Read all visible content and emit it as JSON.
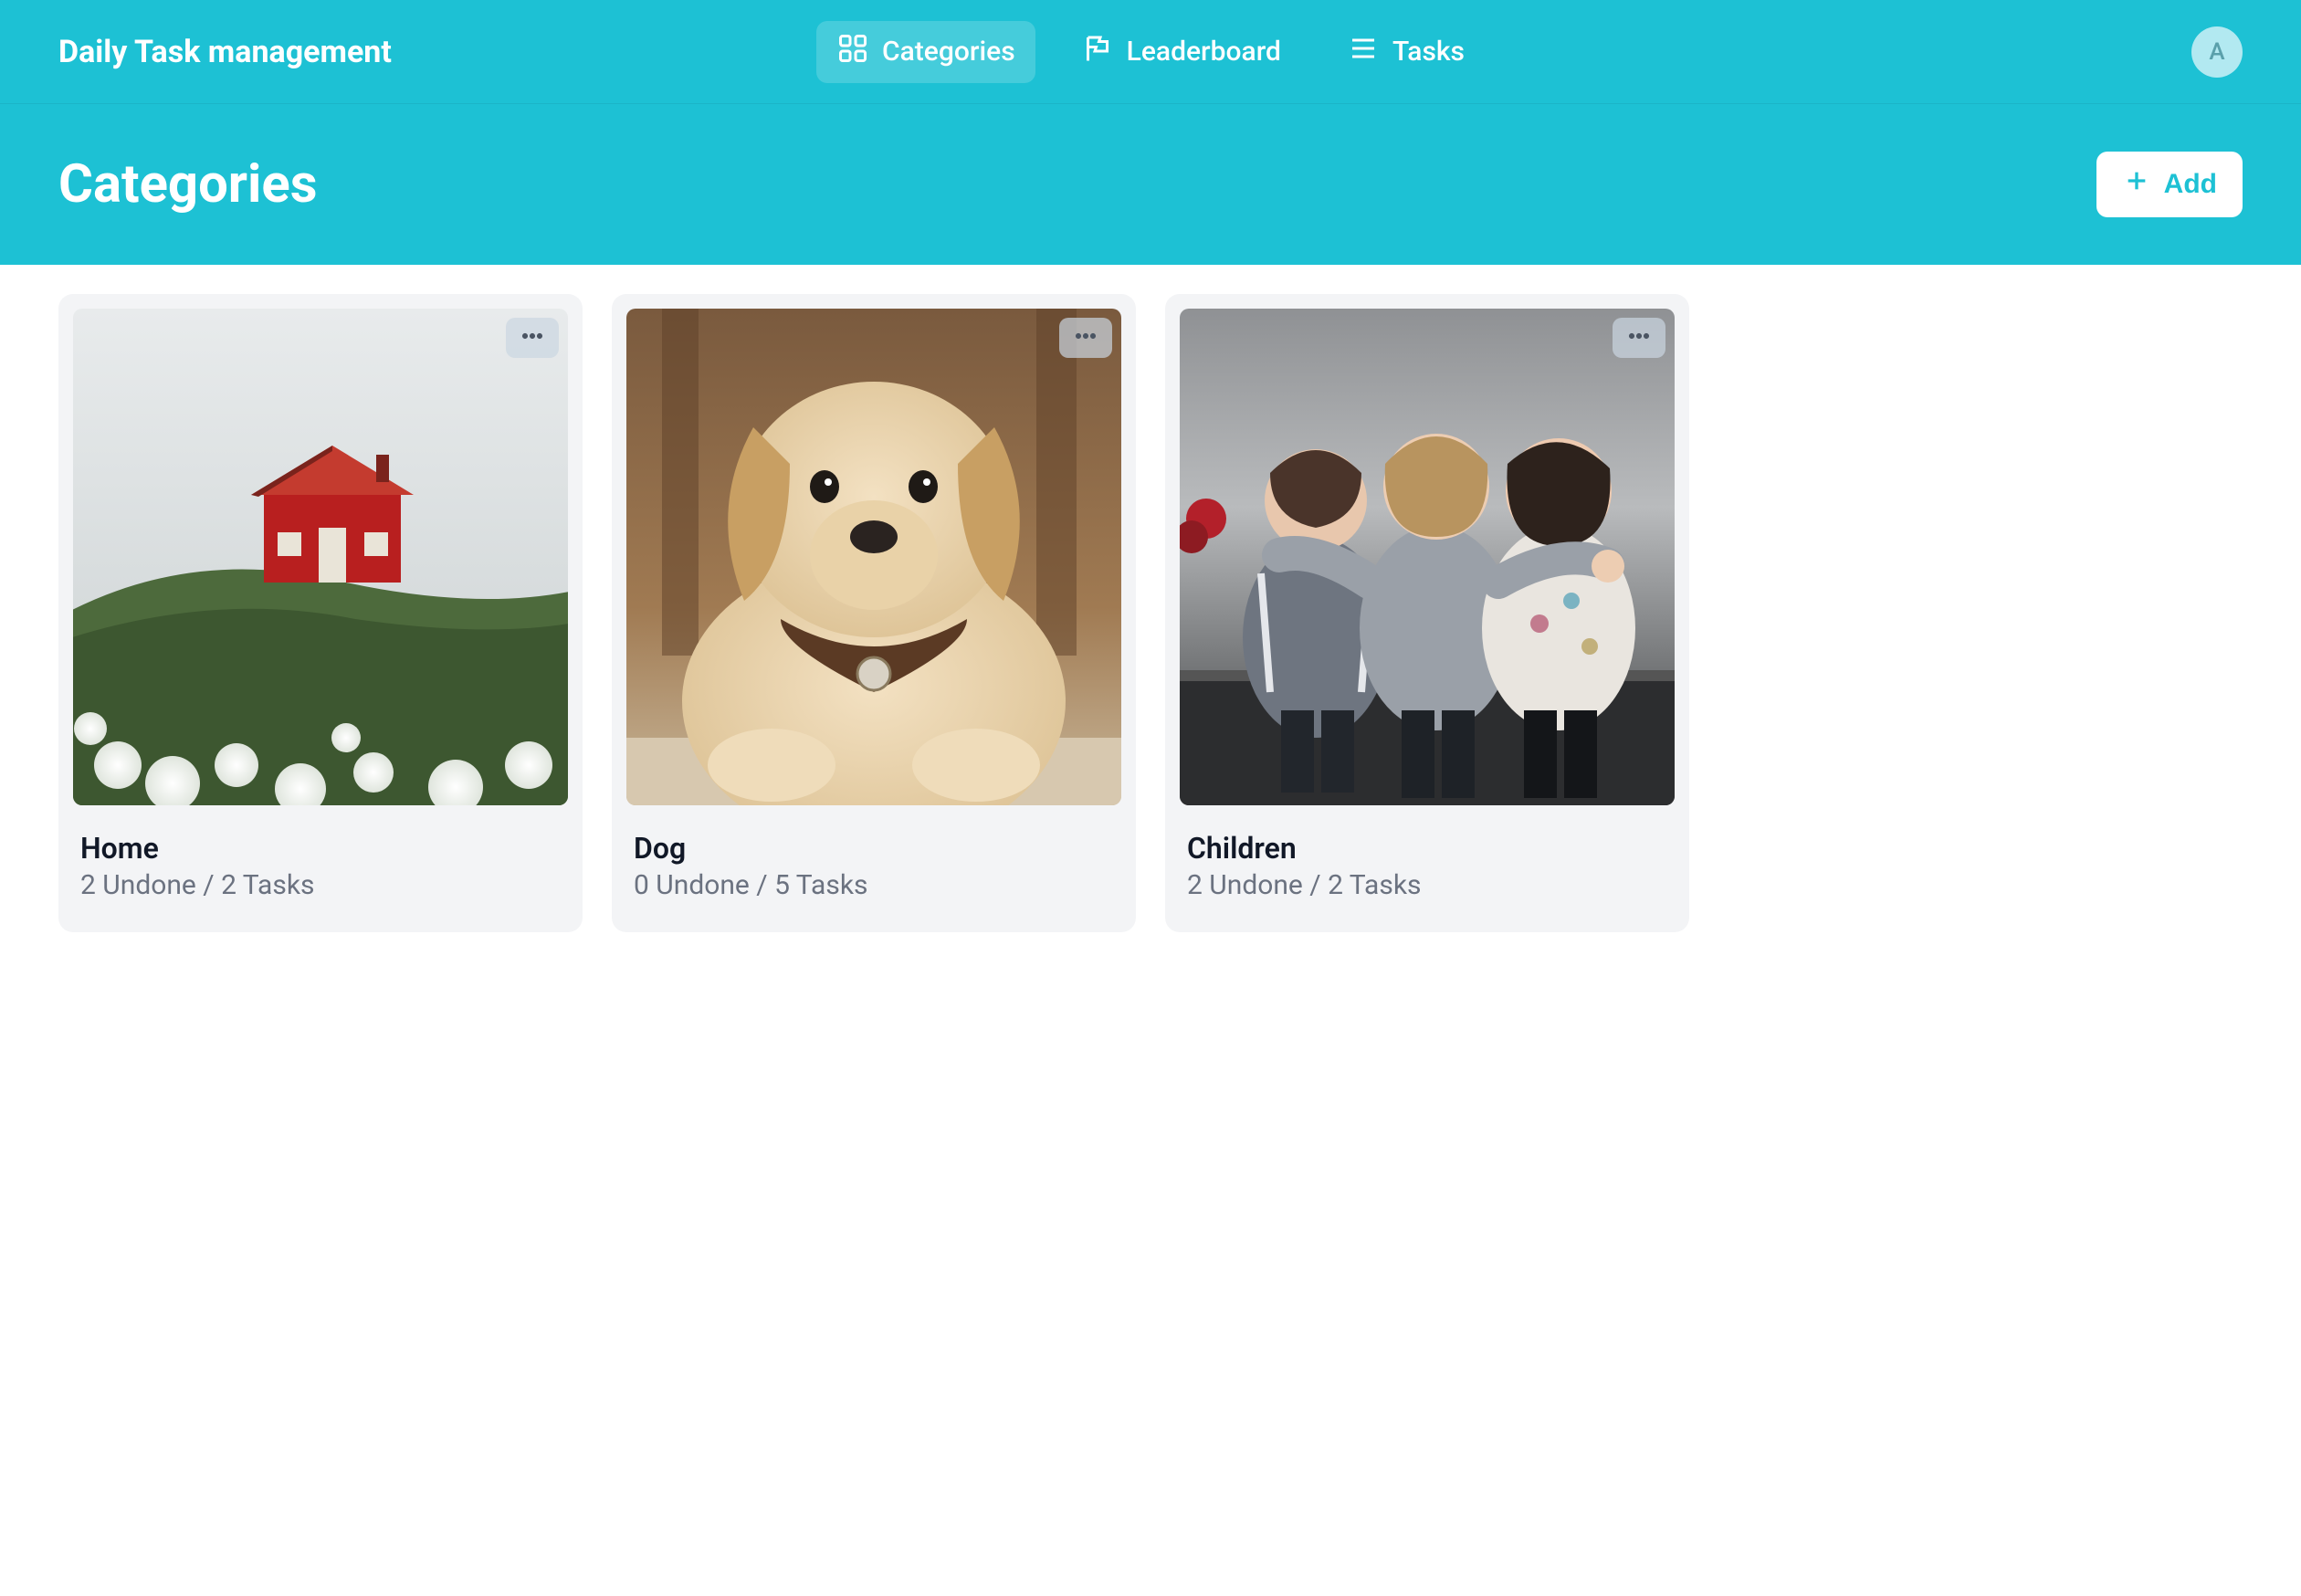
{
  "app_title": "Daily Task management",
  "nav": {
    "items": [
      {
        "label": "Categories",
        "icon": "grid-icon",
        "active": true
      },
      {
        "label": "Leaderboard",
        "icon": "flag-icon",
        "active": false
      },
      {
        "label": "Tasks",
        "icon": "menu-icon",
        "active": false
      }
    ]
  },
  "avatar_initial": "A",
  "page_title": "Categories",
  "add_button": {
    "label": "Add"
  },
  "categories": [
    {
      "title": "Home",
      "subtitle": "2 Undone / 2 Tasks",
      "image": "house"
    },
    {
      "title": "Dog",
      "subtitle": "0 Undone / 5 Tasks",
      "image": "dog"
    },
    {
      "title": "Children",
      "subtitle": "2 Undone / 2 Tasks",
      "image": "children"
    }
  ]
}
